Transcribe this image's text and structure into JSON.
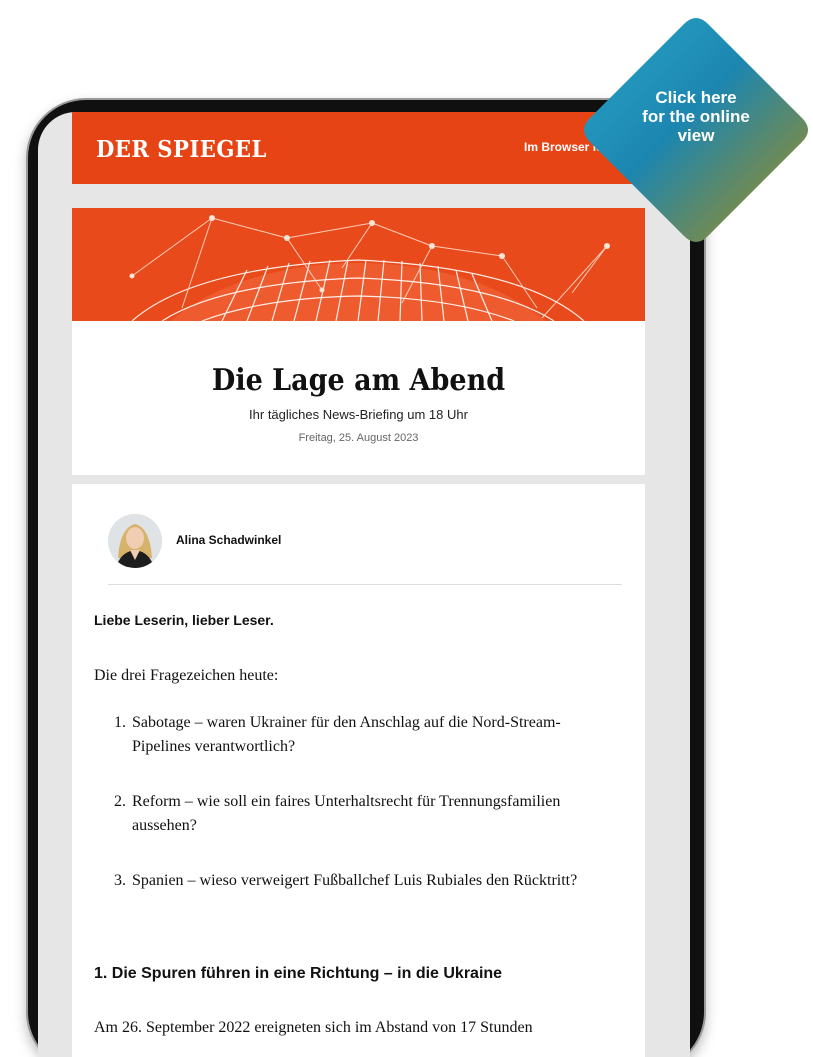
{
  "header": {
    "logo_text": "DER SPIEGEL",
    "browser_link": "Im Browser lesen",
    "background": "#e64415"
  },
  "newsletter": {
    "title": "Die Lage am Abend",
    "subtitle": "Ihr tägliches News-Briefing um 18 Uhr",
    "date": "Freitag, 25. August 2023"
  },
  "author": {
    "name": "Alina Schadwinkel"
  },
  "greeting": "Liebe Leserin, lieber Leser.",
  "intro": "Die drei Fragezeichen heute:",
  "topics": [
    {
      "number": "1.",
      "text": "Sabotage – waren Ukrainer für den Anschlag auf die Nord-Stream-Pipelines verantwortlich?"
    },
    {
      "number": "2.",
      "text": "Reform – wie soll ein faires Unterhaltsrecht für Trennungsfamilien aussehen?"
    },
    {
      "number": "3.",
      "text": "Spanien – wieso verweigert Fußballchef Luis Rubiales den Rücktritt?"
    }
  ],
  "section_1": {
    "heading": "1. Die Spuren führen in eine Richtung – in die Ukraine",
    "body_start": "Am 26. September 2022 ereigneten sich im Abstand von 17 Stunden"
  },
  "badge": {
    "line1": "Click here",
    "line2": "for the online",
    "line3": "view"
  },
  "icons": {
    "avatar": "author-avatar",
    "hero": "globe-network-illustration"
  }
}
